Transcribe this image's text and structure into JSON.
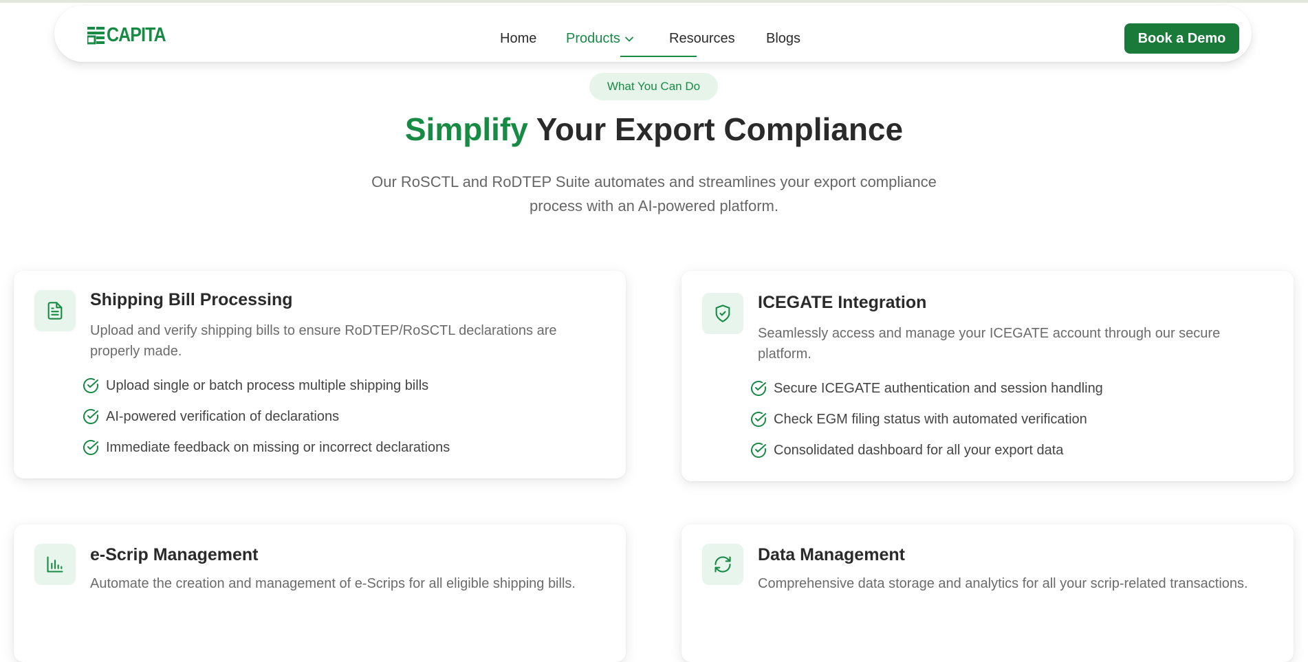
{
  "brand": {
    "logo_text": "CAPITA",
    "color": "#178a44"
  },
  "nav": {
    "links": [
      {
        "label": "Home"
      },
      {
        "label": "Products"
      },
      {
        "label": "Resources"
      },
      {
        "label": "Blogs"
      }
    ],
    "cta": "Book a Demo"
  },
  "hero": {
    "pill": "What You Can Do",
    "title_highlight": "Simplify",
    "title_rest": " Your Export Compliance",
    "subtitle": "Our RoSCTL and RoDTEP Suite automates and streamlines your export compliance process with an AI-powered platform."
  },
  "cards": [
    {
      "icon": "document-icon",
      "title": "Shipping Bill Processing",
      "description": "Upload and verify shipping bills to ensure RoDTEP/RoSCTL declarations are properly made.",
      "features": [
        "Upload single or batch process multiple shipping bills",
        "AI-powered verification of declarations",
        "Immediate feedback on missing or incorrect declarations"
      ]
    },
    {
      "icon": "shield-check-icon",
      "title": "ICEGATE Integration",
      "description": "Seamlessly access and manage your ICEGATE account through our secure platform.",
      "features": [
        "Secure ICEGATE authentication and session handling",
        "Check EGM filing status with automated verification",
        "Consolidated dashboard for all your export data"
      ]
    },
    {
      "icon": "bar-chart-icon",
      "title": "e-Scrip Management",
      "description": "Automate the creation and management of e-Scrips for all eligible shipping bills.",
      "features": []
    },
    {
      "icon": "refresh-icon",
      "title": "Data Management",
      "description": "Comprehensive data storage and analytics for all your scrip-related transactions.",
      "features": []
    }
  ]
}
